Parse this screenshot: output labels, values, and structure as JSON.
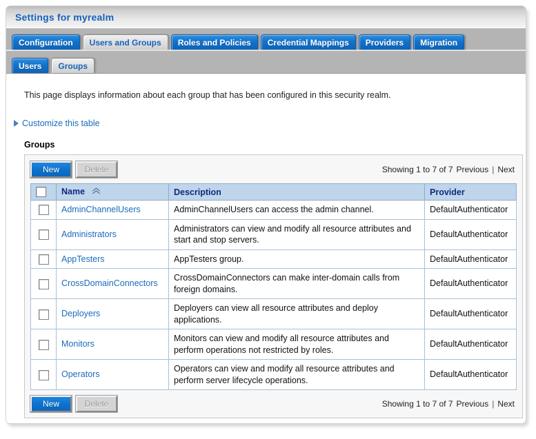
{
  "window": {
    "title": "Settings for myrealm"
  },
  "primary_tabs": [
    {
      "label": "Configuration",
      "state": "unselected"
    },
    {
      "label": "Users and Groups",
      "state": "selected"
    },
    {
      "label": "Roles and Policies",
      "state": "unselected"
    },
    {
      "label": "Credential Mappings",
      "state": "unselected"
    },
    {
      "label": "Providers",
      "state": "unselected"
    },
    {
      "label": "Migration",
      "state": "unselected"
    }
  ],
  "secondary_tabs": [
    {
      "label": "Users",
      "state": "unselected"
    },
    {
      "label": "Groups",
      "state": "selected"
    }
  ],
  "content": {
    "intro": "This page displays information about each group that has been configured in this security realm.",
    "customize_link": "Customize this table",
    "customize_icon": "triangle-right-icon",
    "section_title": "Groups"
  },
  "toolbar": {
    "new_label": "New",
    "delete_label": "Delete",
    "delete_disabled": true
  },
  "paging": {
    "showing": "Showing 1 to 7 of 7",
    "previous": "Previous",
    "separator": "|",
    "next": "Next"
  },
  "table": {
    "columns": [
      {
        "key": "check",
        "label": ""
      },
      {
        "key": "name",
        "label": "Name",
        "sort": "ascending",
        "sort_icon": "sort-ascending-icon"
      },
      {
        "key": "description",
        "label": "Description"
      },
      {
        "key": "provider",
        "label": "Provider"
      }
    ],
    "rows": [
      {
        "checked": false,
        "name": "AdminChannelUsers",
        "description": "AdminChannelUsers can access the admin channel.",
        "provider": "DefaultAuthenticator"
      },
      {
        "checked": false,
        "name": "Administrators",
        "description": "Administrators can view and modify all resource attributes and start and stop servers.",
        "provider": "DefaultAuthenticator"
      },
      {
        "checked": false,
        "name": "AppTesters",
        "description": "AppTesters group.",
        "provider": "DefaultAuthenticator"
      },
      {
        "checked": false,
        "name": "CrossDomainConnectors",
        "description": "CrossDomainConnectors can make inter-domain calls from foreign domains.",
        "provider": "DefaultAuthenticator"
      },
      {
        "checked": false,
        "name": "Deployers",
        "description": "Deployers can view all resource attributes and deploy applications.",
        "provider": "DefaultAuthenticator"
      },
      {
        "checked": false,
        "name": "Monitors",
        "description": "Monitors can view and modify all resource attributes and perform operations not restricted by roles.",
        "provider": "DefaultAuthenticator"
      },
      {
        "checked": false,
        "name": "Operators",
        "description": "Operators can view and modify all resource attributes and perform server lifecycle operations.",
        "provider": "DefaultAuthenticator"
      }
    ]
  },
  "colors": {
    "tab_blue": "#0f72cd",
    "link_blue": "#1a6bbd",
    "title_blue": "#1762bb",
    "header_row": "#bed5ec",
    "header_text": "#14287d",
    "tabstrip_gray": "#b4b4b4"
  }
}
